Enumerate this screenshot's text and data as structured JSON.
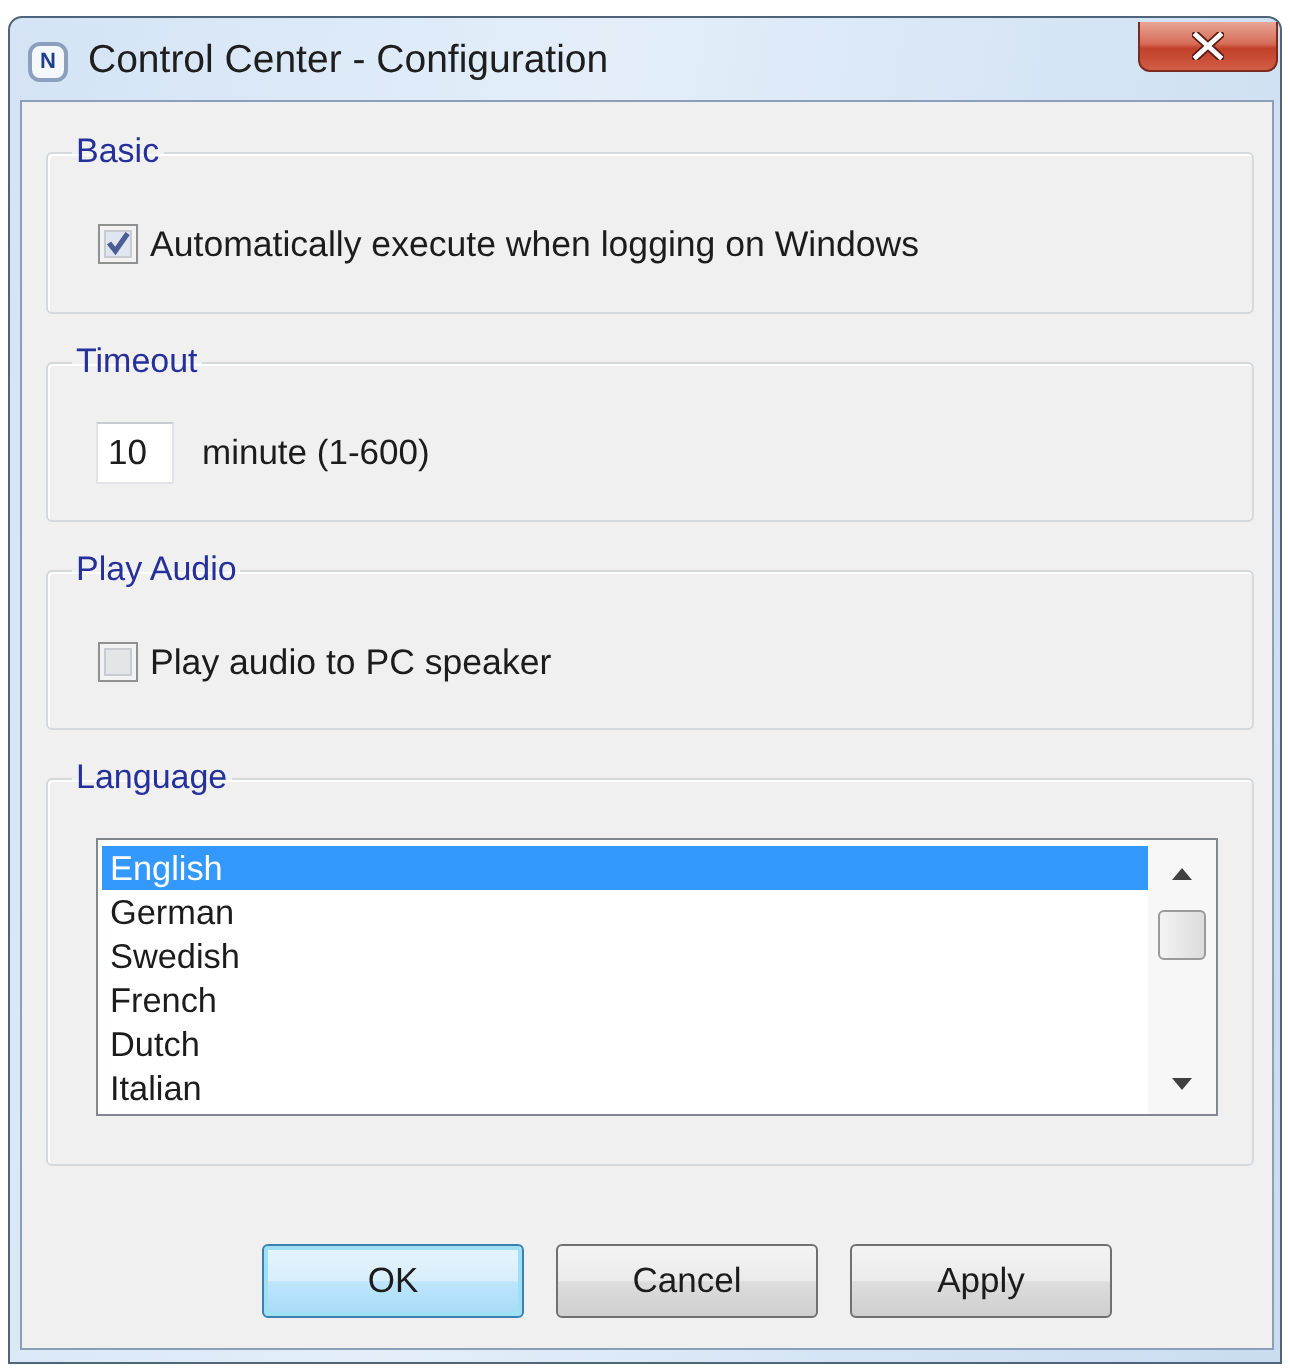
{
  "window": {
    "logo": "N",
    "title": "Control Center - Configuration"
  },
  "groups": [
    {
      "kind": "checkbox",
      "title": "Basic",
      "label": "Automatically execute when logging on Windows",
      "checked": true
    },
    {
      "kind": "number",
      "title": "Timeout",
      "value": "10",
      "unit": "minute (1-600)"
    },
    {
      "kind": "checkbox",
      "title": "Play Audio",
      "label": "Play audio to PC speaker",
      "checked": false
    },
    {
      "kind": "list",
      "title": "Language",
      "items": [
        {
          "label": "English",
          "selected": true
        },
        {
          "label": "German",
          "selected": false
        },
        {
          "label": "Swedish",
          "selected": false
        },
        {
          "label": "French",
          "selected": false
        },
        {
          "label": "Dutch",
          "selected": false
        },
        {
          "label": "Italian",
          "selected": false
        }
      ]
    }
  ],
  "buttons": [
    {
      "label": "OK",
      "default": true
    },
    {
      "label": "Cancel",
      "default": false
    },
    {
      "label": "Apply",
      "default": false
    }
  ]
}
